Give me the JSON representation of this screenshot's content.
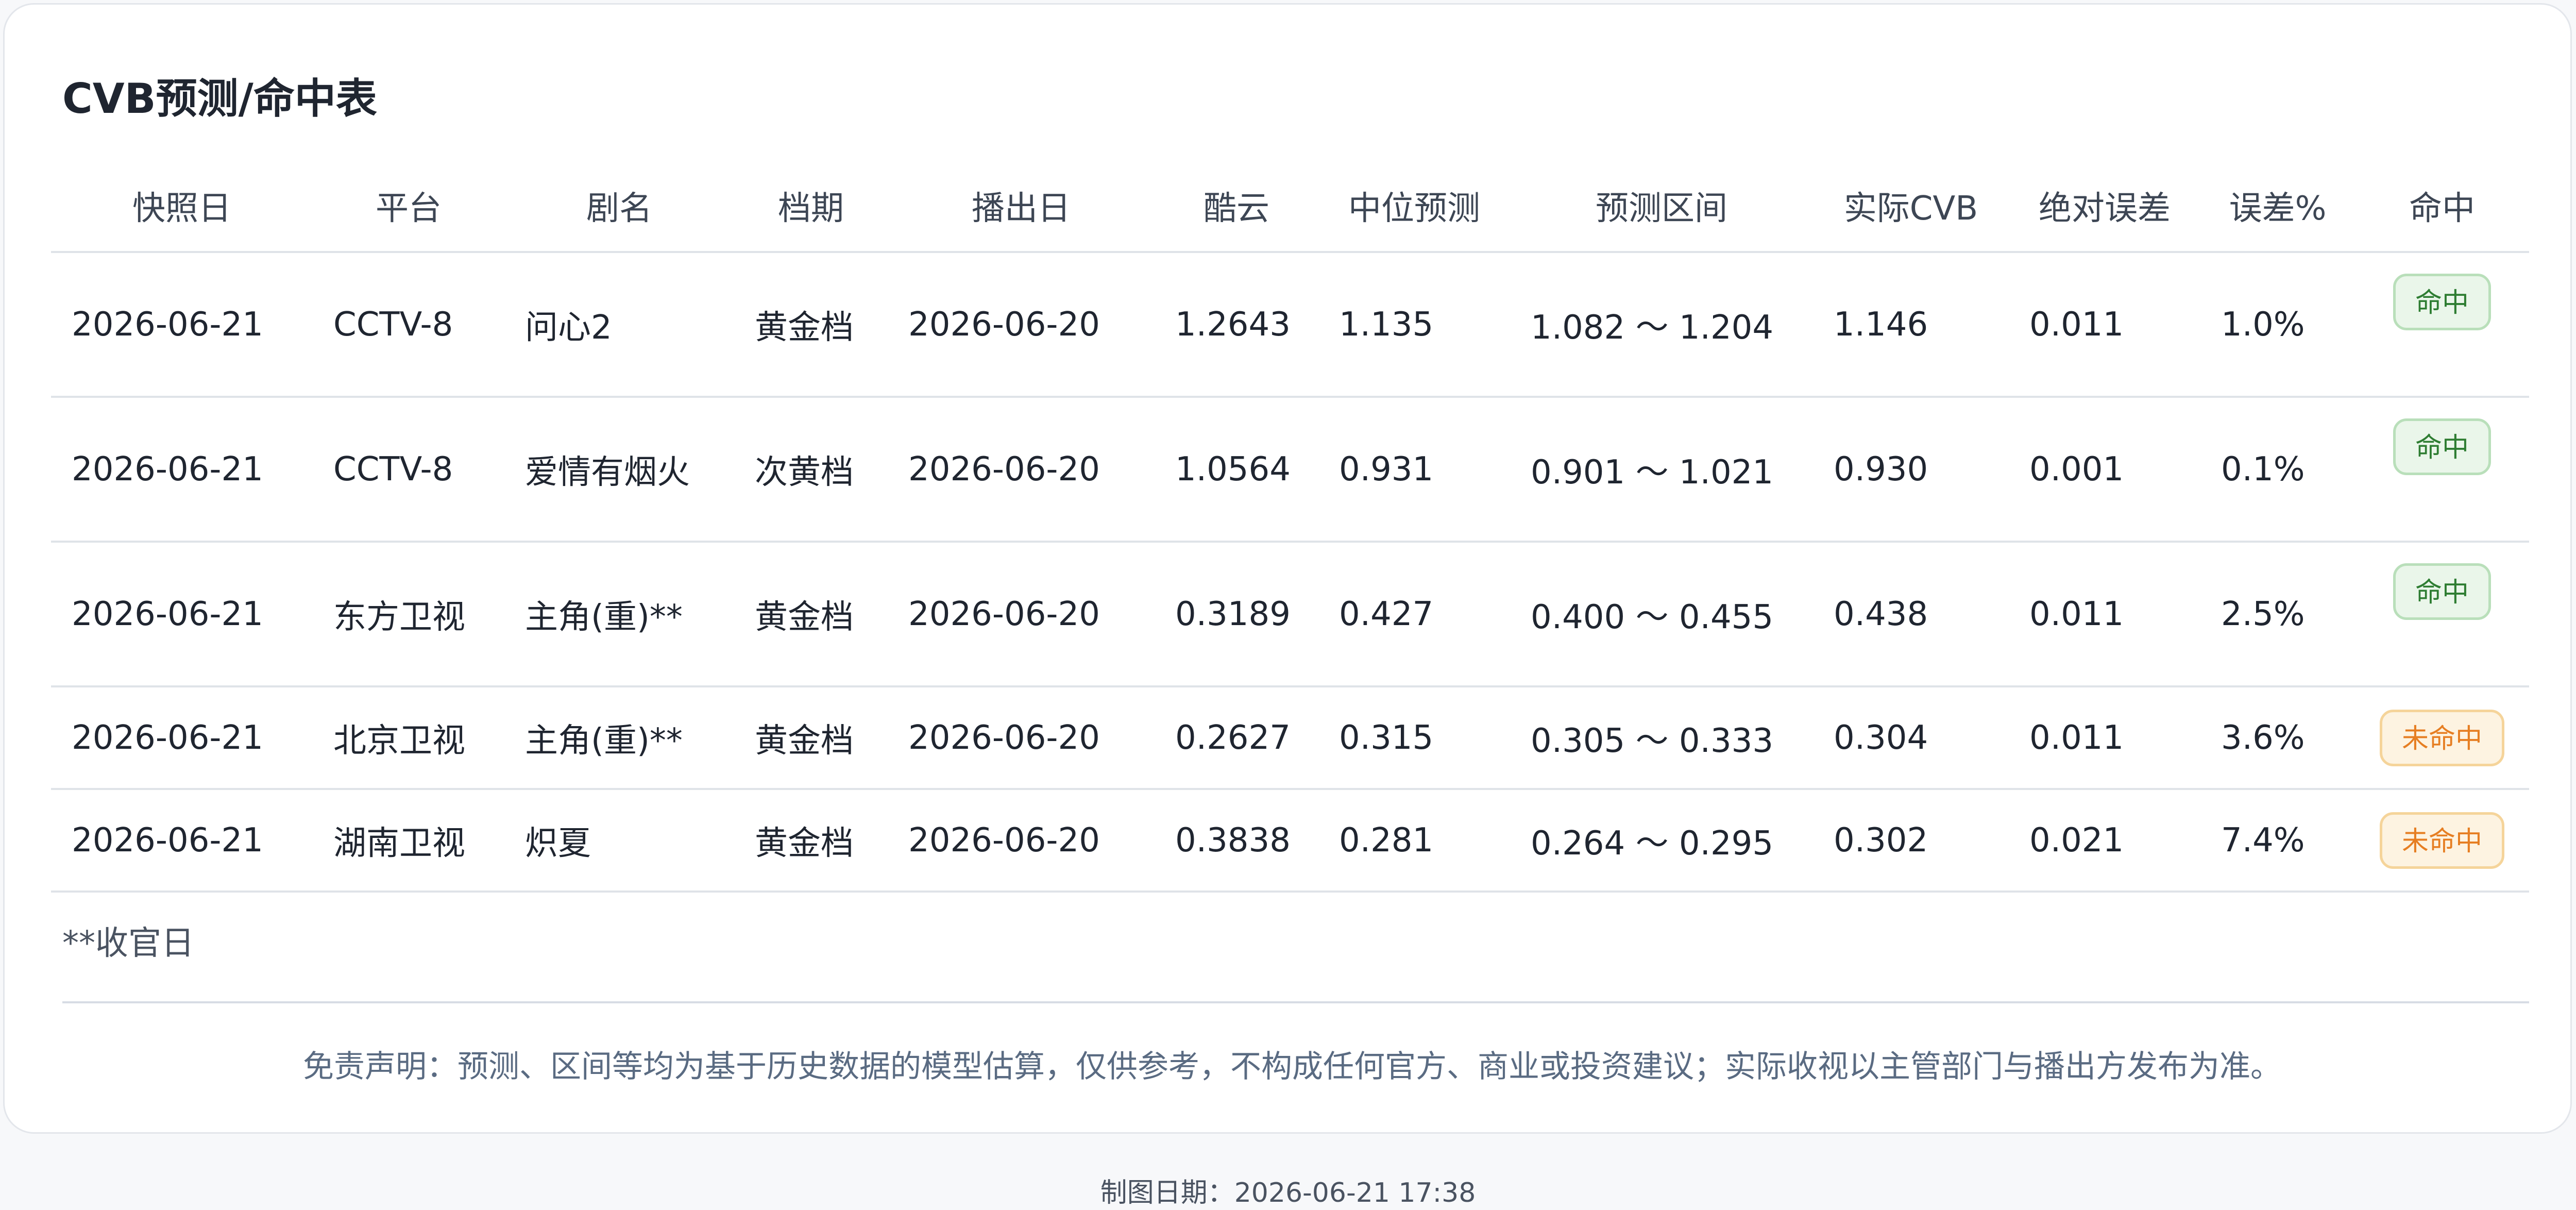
{
  "title": "CVB预测/命中表",
  "columns": [
    "快照日",
    "平台",
    "剧名",
    "档期",
    "播出日",
    "酷云",
    "中位预测",
    "预测区间",
    "实际CVB",
    "绝对误差",
    "误差%",
    "命中"
  ],
  "rows": [
    {
      "snapshot": "2026-06-21",
      "platform": "CCTV-8",
      "drama": "问心2",
      "slot": "黄金档",
      "air_date": "2026-06-20",
      "kuyun": "1.2643",
      "median": "1.135",
      "interval": "1.082 ～ 1.204",
      "actual": "1.146",
      "abs_error": "0.011",
      "error_pct": "1.0%",
      "hit": "命中",
      "hit_status": "hit"
    },
    {
      "snapshot": "2026-06-21",
      "platform": "CCTV-8",
      "drama": "爱情有烟火",
      "slot": "次黄档",
      "air_date": "2026-06-20",
      "kuyun": "1.0564",
      "median": "0.931",
      "interval": "0.901 ～ 1.021",
      "actual": "0.930",
      "abs_error": "0.001",
      "error_pct": "0.1%",
      "hit": "命中",
      "hit_status": "hit"
    },
    {
      "snapshot": "2026-06-21",
      "platform": "东方卫视",
      "drama": "主角(重)**",
      "slot": "黄金档",
      "air_date": "2026-06-20",
      "kuyun": "0.3189",
      "median": "0.427",
      "interval": "0.400 ～ 0.455",
      "actual": "0.438",
      "abs_error": "0.011",
      "error_pct": "2.5%",
      "hit": "命中",
      "hit_status": "hit"
    },
    {
      "snapshot": "2026-06-21",
      "platform": "北京卫视",
      "drama": "主角(重)**",
      "slot": "黄金档",
      "air_date": "2026-06-20",
      "kuyun": "0.2627",
      "median": "0.315",
      "interval": "0.305 ～ 0.333",
      "actual": "0.304",
      "abs_error": "0.011",
      "error_pct": "3.6%",
      "hit": "未命中",
      "hit_status": "miss"
    },
    {
      "snapshot": "2026-06-21",
      "platform": "湖南卫视",
      "drama": "炽夏",
      "slot": "黄金档",
      "air_date": "2026-06-20",
      "kuyun": "0.3838",
      "median": "0.281",
      "interval": "0.264 ～ 0.295",
      "actual": "0.302",
      "abs_error": "0.021",
      "error_pct": "7.4%",
      "hit": "未命中",
      "hit_status": "miss"
    }
  ],
  "footnote": "**收官日",
  "disclaimer": "免责声明：预测、区间等均为基于历史数据的模型估算，仅供参考，不构成任何官方、商业或投资建议；实际收视以主管部门与播出方发布为准。",
  "made_date": "制图日期：2026-06-21 17:38",
  "colors": {
    "hit_text": "#2e7d32",
    "hit_bg": "#eaf6ea",
    "miss_text": "#e67e22",
    "miss_bg": "#fdf3e1",
    "disclaimer_text": "#5a6b82"
  }
}
